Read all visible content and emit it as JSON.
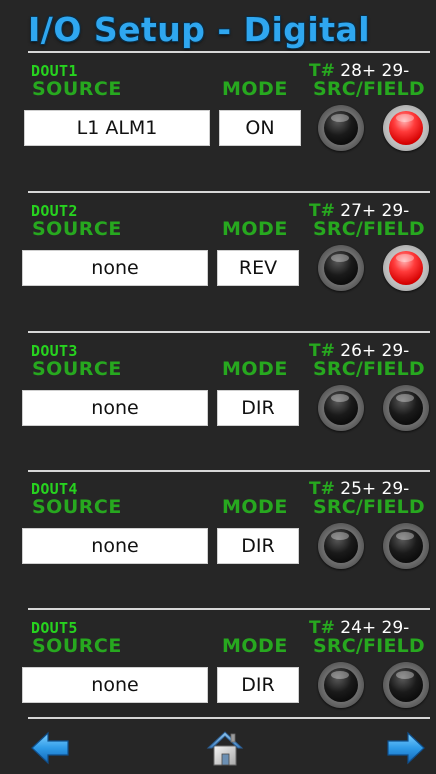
{
  "screen": {
    "title": "I/O Setup - Digital"
  },
  "labels": {
    "source": "SOURCE",
    "mode": "MODE",
    "terminal_prefix": "T#",
    "src_field": "SRC/FIELD"
  },
  "outputs": [
    {
      "name": "DOUT1",
      "terminals": "28+ 29-",
      "source": "L1 ALM1",
      "mode": "ON",
      "src_led": "off",
      "field_led": "on"
    },
    {
      "name": "DOUT2",
      "terminals": "27+ 29-",
      "source": "none",
      "mode": "REV",
      "src_led": "off",
      "field_led": "on"
    },
    {
      "name": "DOUT3",
      "terminals": "26+ 29-",
      "source": "none",
      "mode": "DIR",
      "src_led": "off",
      "field_led": "off"
    },
    {
      "name": "DOUT4",
      "terminals": "25+ 29-",
      "source": "none",
      "mode": "DIR",
      "src_led": "off",
      "field_led": "off"
    },
    {
      "name": "DOUT5",
      "terminals": "24+ 29-",
      "source": "none",
      "mode": "DIR",
      "src_led": "off",
      "field_led": "off"
    }
  ],
  "navigation": {
    "back_icon": "left-arrow-icon",
    "home_icon": "home-icon",
    "forward_icon": "right-arrow-icon"
  },
  "colors": {
    "title": "#2fa7f0",
    "label_green": "#27a81f",
    "dout_green": "#27d21f",
    "background": "#262626",
    "led_on": "#ff3a3a",
    "led_off": "#111111",
    "arrow_blue": "#2f9be8"
  }
}
